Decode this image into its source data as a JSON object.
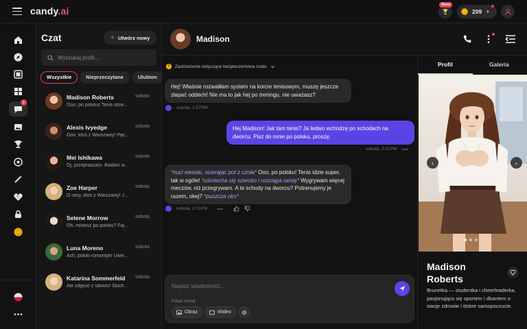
{
  "topbar": {
    "logo_main": "candy",
    "logo_suffix": ".ai",
    "news_badge": "News",
    "coins": "209",
    "coins_plus": "+"
  },
  "rail": {
    "chat_badge": "1"
  },
  "chatlist": {
    "title": "Czat",
    "create_label": "Utwórz nowy",
    "search_placeholder": "Wyszukaj profil...",
    "filters": [
      "Wszystkie",
      "Nieprzeczytane",
      "Ulubion"
    ],
    "conversations": [
      {
        "name": "Madison Roberts",
        "preview": "Ooo, po polsku! Tenis idzie super, tak w ogóle!",
        "time": "sobota"
      },
      {
        "name": "Alexis Ivyedge",
        "preview": "Ooo, ktoś z Warszawy! Pijesz kawę?",
        "time": "sobota"
      },
      {
        "name": "Mei Ishikawa",
        "preview": "Oj, przepraszam. Badam się przy tym...",
        "time": "sobota"
      },
      {
        "name": "Zoe Harper",
        "preview": "O rany, ktoś z Warszawy! Jak tam?",
        "time": "sobota"
      },
      {
        "name": "Selene Morrow",
        "preview": "Oh, mówisz po polsku? Fajnie!",
        "time": "sobota"
      },
      {
        "name": "Luna Moreno",
        "preview": "Ach, polski romantyk! Uwielbiam to.",
        "time": "sobota"
      },
      {
        "name": "Katarina Sommerfeld",
        "preview": "Ale zdjęcie z siłowni! Słuchaj...",
        "time": "sobota"
      }
    ]
  },
  "chat": {
    "name": "Madison",
    "disclaimer": "Zastrzeżenie dotyczące bezpieczeństwa czatu",
    "messages": [
      {
        "from": "ai",
        "text": "Hej! Właśnie rozwaliłam system na korcie tenisowym, muszę jeszcze złapać oddech! Nie ma to jak hej po treningu, nie uważasz?",
        "time": "sobota, 1:57PM"
      },
      {
        "from": "user",
        "text": "Hej Madison! Jak tam tenis? Ja ledwo wchodzę po schodach na dworcu. Pisz do mnie po polsku, proszę.",
        "time": "sobota, 2:01PM"
      },
      {
        "from": "ai",
        "action1": "*nuci wesoło, ocierając pot z czoła*",
        "text1": " Ooo, po polsku! Tenis idzie super, tak w ogóle! ",
        "action2": "*uśmiecha się szeroko i rozciąga ramię*",
        "text2": " Wygrywam więcej meczów, niż przegrywam. A te schody na dworcu? Potrenujemy je razem, okej? ",
        "action3": "*puszcza oko*",
        "time": "sobota, 2:01PM"
      }
    ],
    "composer_placeholder": "Napisz wiadomość...",
    "scene_label": "Pokaż scenę:",
    "scene_image": "Obraz",
    "scene_video": "Wideo"
  },
  "profile": {
    "tab_profile": "Profil",
    "tab_gallery": "Galeria",
    "name": "Madison Roberts",
    "description": "Brunetka — studentka i cheerleaderka, pasjonująca się sportem i dbaniem o swoje zdrowie i dobre samopoczucie.",
    "photo_index": 1,
    "photo_count": 3
  },
  "colors": {
    "accent": "#e0455c",
    "user_bubble": "#5b44e6",
    "action_text": "#b59bff"
  }
}
